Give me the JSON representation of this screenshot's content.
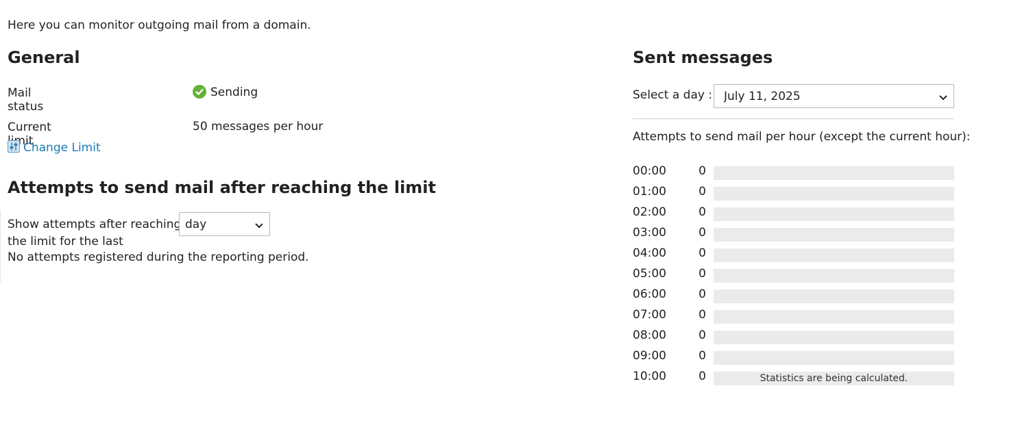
{
  "intro": "Here you can monitor outgoing mail from a domain.",
  "general": {
    "heading": "General",
    "mail_status_label": "Mail status",
    "mail_status_value": "Sending",
    "current_limit_label": "Current limit",
    "current_limit_value": "50 messages per hour",
    "change_limit_link": "Change Limit"
  },
  "attempts": {
    "heading": "Attempts to send mail after reaching the limit",
    "show_label_line1": "Show attempts after reaching",
    "show_label_line2": "the limit for the last",
    "period_select_value": "day",
    "empty_message": "No attempts registered during the reporting period."
  },
  "sent": {
    "heading": "Sent messages",
    "select_day_label": "Select a day :",
    "selected_day": "July 11, 2025",
    "subtitle": "Attempts to send mail per hour (except the current hour):",
    "hours": [
      {
        "hour": "00:00",
        "count": "0",
        "note": ""
      },
      {
        "hour": "01:00",
        "count": "0",
        "note": ""
      },
      {
        "hour": "02:00",
        "count": "0",
        "note": ""
      },
      {
        "hour": "03:00",
        "count": "0",
        "note": ""
      },
      {
        "hour": "04:00",
        "count": "0",
        "note": ""
      },
      {
        "hour": "05:00",
        "count": "0",
        "note": ""
      },
      {
        "hour": "06:00",
        "count": "0",
        "note": ""
      },
      {
        "hour": "07:00",
        "count": "0",
        "note": ""
      },
      {
        "hour": "08:00",
        "count": "0",
        "note": ""
      },
      {
        "hour": "09:00",
        "count": "0",
        "note": ""
      },
      {
        "hour": "10:00",
        "count": "0",
        "note": "Statistics are being calculated."
      }
    ]
  },
  "colors": {
    "link": "#1a7bb3",
    "status_ok": "#62b236",
    "bar_track": "#ebebeb"
  }
}
